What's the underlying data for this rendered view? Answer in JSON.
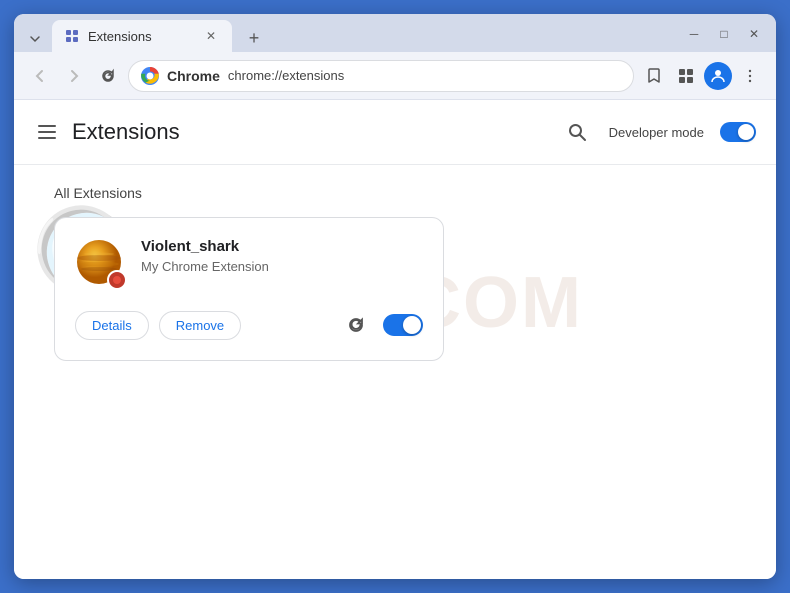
{
  "browser": {
    "tab_title": "Extensions",
    "tab_favicon": "puzzle-icon",
    "url_brand": "Chrome",
    "url_address": "chrome://extensions",
    "window_minimize": "─",
    "window_maximize": "□",
    "window_close": "✕"
  },
  "nav": {
    "back": "←",
    "forward": "→",
    "reload": "↻"
  },
  "page": {
    "title": "Extensions",
    "hamburger_icon": "menu-icon",
    "search_icon": "search-icon",
    "dev_mode_label": "Developer mode",
    "all_extensions_label": "All Extensions"
  },
  "extension": {
    "name": "Violent_shark",
    "description": "My Chrome Extension",
    "details_btn": "Details",
    "remove_btn": "Remove",
    "enabled": true
  },
  "watermark": {
    "text": "RISK.COM"
  }
}
